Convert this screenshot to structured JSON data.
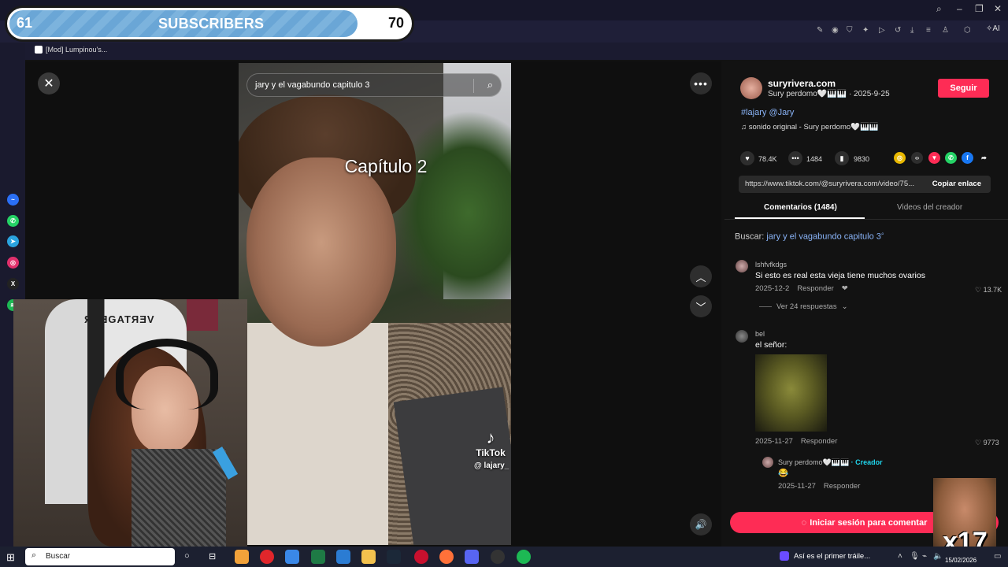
{
  "overlay": {
    "left_num": "61",
    "center_label": "SUBSCRIBERS",
    "right_num": "70",
    "fill_fraction": 0.87
  },
  "bookmarks": {
    "item": "[Mod] Lumpinou's..."
  },
  "toolbar": {
    "ai_label": "AI"
  },
  "video": {
    "search_query": "jary y el vagabundo capitulo 3",
    "caption": "Capítulo 2",
    "logo_text": "TikTok",
    "handle": "@ lajary_"
  },
  "post": {
    "author": "suryrivera.com",
    "author_sub": "Sury perdomo🤍🎹🎹 · 2025-9-25",
    "follow_label": "Seguir",
    "hashtags": "#lajary @Jary",
    "sound": "♫  sonido original - Sury perdomo🤍🎹🎹",
    "likes": "78.4K",
    "comments": "1484",
    "saves": "9830",
    "link": "https://www.tiktok.com/@suryrivera.com/video/75...",
    "copy_label": "Copiar enlace"
  },
  "tabs": {
    "comments": "Comentarios (1484)",
    "videos": "Videos del creador"
  },
  "search_prompt": {
    "label": "Buscar:",
    "query": "jary y el vagabundo capitulo 3"
  },
  "comments": [
    {
      "user": "lshfvfkdgs",
      "text": "Si esto es real esta vieja tiene muchos ovarios",
      "date": "2025-12-2",
      "reply": "Responder",
      "likes": "13.7K",
      "replies": "Ver 24 respuestas"
    },
    {
      "user": "bel",
      "text": "el señor:",
      "date": "2025-11-27",
      "reply": "Responder",
      "likes": "9773"
    },
    {
      "user": "Sury perdomo🤍🎹🎹",
      "creator_tag": "· Creador",
      "text": "😂",
      "date": "2025-11-27",
      "reply": "Responder"
    }
  ],
  "login_label": "Iniciar sesión para comentar",
  "emote_text": "x17",
  "webcam": {
    "chair_text": "ЯAƎGATЯƎV"
  },
  "taskbar": {
    "search_placeholder": "Buscar",
    "news": "Así es el primer tráile...",
    "date": "15/02/2026"
  }
}
